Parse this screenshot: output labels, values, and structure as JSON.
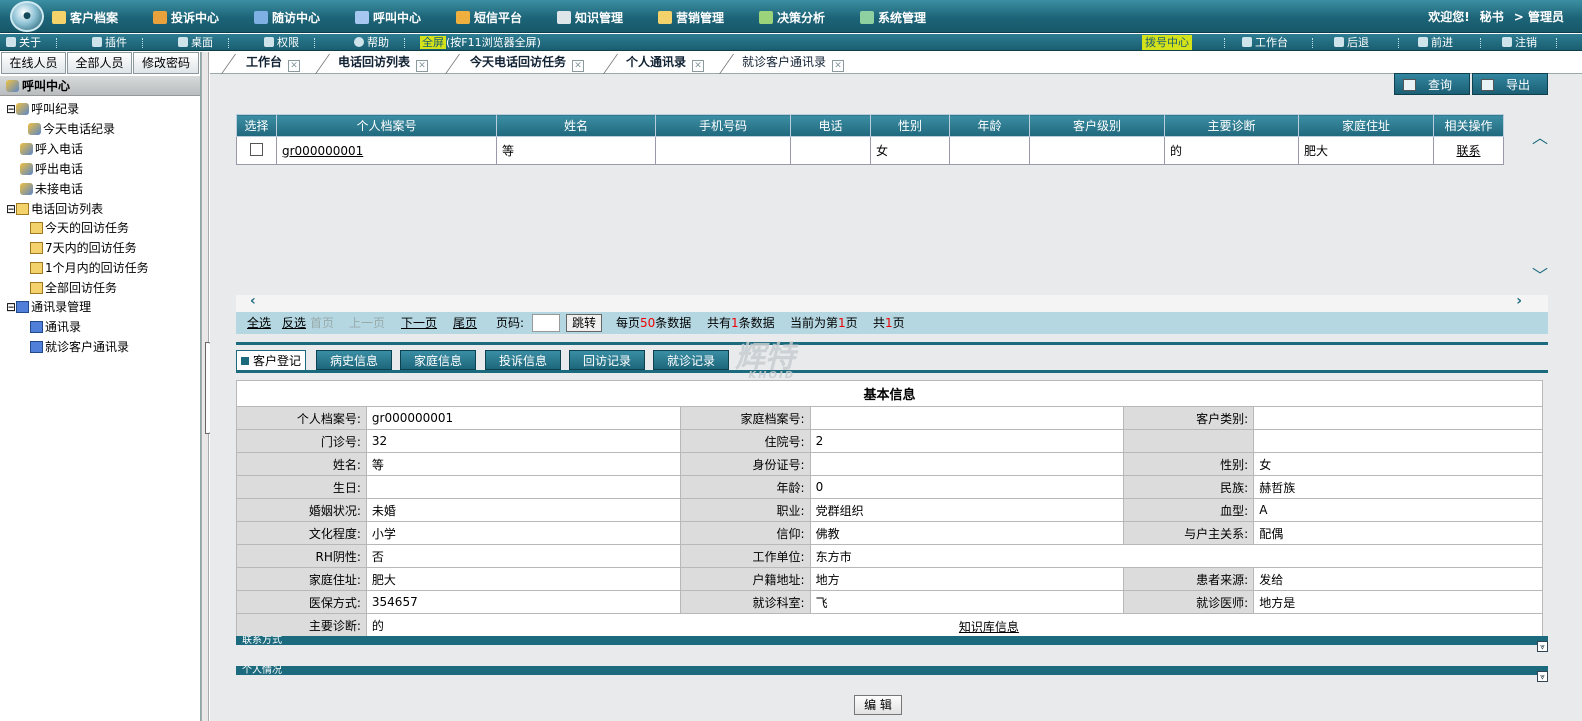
{
  "topnav": {
    "items": [
      "客户档案",
      "投诉中心",
      "随访中心",
      "呼叫中心",
      "短信平台",
      "知识管理",
      "营销管理",
      "决策分析",
      "系统管理"
    ],
    "welcome": "欢迎您!",
    "user_role": "秘书",
    "user_name": "> 管理员"
  },
  "toolbar": {
    "about": "关于",
    "plugin": "插件",
    "desktop": "桌面",
    "permission": "权限",
    "help": "帮助",
    "fullscreen_label": "全屏",
    "fullscreen_hint": "(按F11浏览器全屏)",
    "dial_center": "拨号中心",
    "workbench": "工作台",
    "back": "后退",
    "forward": "前进",
    "logout": "注销"
  },
  "sidebar": {
    "tabs": [
      "在线人员",
      "全部人员",
      "修改密码"
    ],
    "section_title": "呼叫中心",
    "tree": [
      "呼叫纪录",
      "今天电话纪录",
      "呼入电话",
      "呼出电话",
      "未接电话",
      "电话回访列表",
      "今天的回访任务",
      "7天内的回访任务",
      "1个月内的回访任务",
      "全部回访任务",
      "通讯录管理",
      "通讯录",
      "就诊客户通讯录"
    ]
  },
  "tabs": [
    "工作台",
    "电话回访列表",
    "今天电话回访任务",
    "个人通讯录",
    "就诊客户通讯录"
  ],
  "actions": {
    "query": "查询",
    "export": "导出"
  },
  "grid": {
    "headers": [
      "选择",
      "个人档案号",
      "姓名",
      "手机号码",
      "电话",
      "性别",
      "年龄",
      "客户级别",
      "主要诊断",
      "家庭住址",
      "相关操作"
    ],
    "row": {
      "record_no": "gr000000001",
      "name": "等",
      "mobile": "",
      "phone": "",
      "gender": "女",
      "age": "",
      "level": "",
      "diagnosis": "的",
      "address": "肥大",
      "action": "联系"
    }
  },
  "pager": {
    "select_all": "全选",
    "invert": "反选",
    "first": "首页",
    "prev": "上一页",
    "next": "下一页",
    "last": "尾页",
    "page_label": "页码:",
    "jump": "跳转",
    "per_page_pre": "每页",
    "per_page": "50",
    "per_page_post": "条数据",
    "total_pre": "共有",
    "total": "1",
    "total_post": "条数据",
    "current_pre": "当前为第",
    "current": "1",
    "current_post": "页",
    "pages_pre": "共",
    "pages": "1",
    "pages_post": "页"
  },
  "detail_tabs": [
    "客户登记",
    "病史信息",
    "家庭信息",
    "投诉信息",
    "回访记录",
    "就诊记录"
  ],
  "info": {
    "title": "基本信息",
    "rows": [
      [
        [
          "个人档案号:",
          "gr000000001"
        ],
        [
          "家庭档案号:",
          ""
        ],
        [
          "客户类别:",
          ""
        ]
      ],
      [
        [
          "门诊号:",
          "32"
        ],
        [
          "住院号:",
          "2"
        ],
        [
          "",
          ""
        ]
      ],
      [
        [
          "姓名:",
          "等"
        ],
        [
          "身份证号:",
          ""
        ],
        [
          "性别:",
          "女"
        ]
      ],
      [
        [
          "生日:",
          ""
        ],
        [
          "年龄:",
          "0"
        ],
        [
          "民族:",
          "赫哲族"
        ]
      ],
      [
        [
          "婚姻状况:",
          "未婚"
        ],
        [
          "职业:",
          "党群组织"
        ],
        [
          "血型:",
          "A"
        ]
      ],
      [
        [
          "文化程度:",
          "小学"
        ],
        [
          "信仰:",
          "佛教"
        ],
        [
          "与户主关系:",
          "配偶"
        ]
      ],
      [
        [
          "RH阴性:",
          "否"
        ],
        [
          "工作单位:",
          "东方市"
        ]
      ],
      [
        [
          "家庭住址:",
          "肥大"
        ],
        [
          "户籍地址:",
          "地方"
        ],
        [
          "患者来源:",
          "发给"
        ]
      ],
      [
        [
          "医保方式:",
          "354657"
        ],
        [
          "就诊科室:",
          "飞"
        ],
        [
          "就诊医师:",
          "地方是"
        ]
      ],
      [
        [
          "主要诊断:",
          "的"
        ],
        [
          "",
          "知识库信息"
        ]
      ]
    ]
  },
  "sections": [
    "联系方式",
    "个人情况"
  ],
  "edit_button": "编 辑",
  "watermark": {
    "main": "辉特",
    "sub": "KHOID"
  }
}
